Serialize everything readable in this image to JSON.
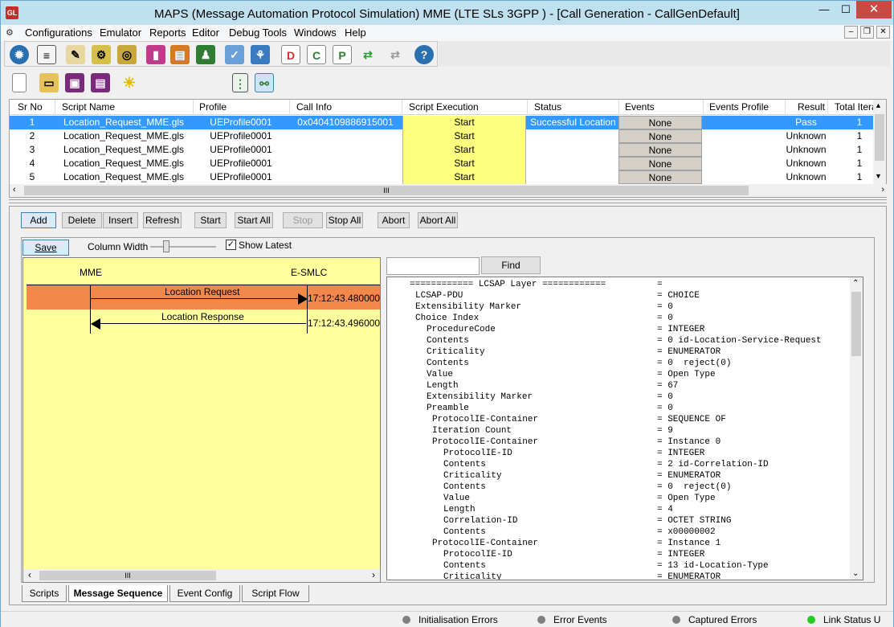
{
  "window": {
    "title": "MAPS (Message Automation Protocol Simulation) MME (LTE SLs 3GPP ) - [Call Generation  - CallGenDefault]",
    "app_icon": "GL",
    "controls": {
      "minimize": "—",
      "maximize": "☐",
      "close": "✕"
    }
  },
  "menu": {
    "items": [
      "Configurations",
      "Emulator",
      "Reports",
      "Editor",
      "Debug Tools",
      "Windows",
      "Help"
    ],
    "mdi_controls": {
      "minimize": "–",
      "restore": "❐",
      "close": "✕"
    }
  },
  "toolbar": {
    "icons": [
      "gear-icon",
      "notepad-icon",
      "script-edit-icon",
      "gears-icon",
      "coins-icon",
      "books-icon",
      "briefcase-icon",
      "user-lock-icon",
      "checklist-icon",
      "network-icon",
      "d-file-icon",
      "c-file-icon",
      "p-file-icon",
      "c-arrow-icon",
      "d-arrow-icon",
      "help-icon"
    ],
    "help_label": "?"
  },
  "grid": {
    "columns": [
      "Sr No",
      "Script Name",
      "Profile",
      "Call Info",
      "Script Execution",
      "Status",
      "Events",
      "Events Profile",
      "Result",
      "Total Itera"
    ],
    "rows": [
      {
        "sr": "1",
        "script": "Location_Request_MME.gls",
        "profile": "UEProfile0001",
        "callinfo": "0x0404109886915001",
        "exec": "Start",
        "status": "Successful Location ...",
        "events": "None",
        "events_profile": "",
        "result": "Pass",
        "iter": "1"
      },
      {
        "sr": "2",
        "script": "Location_Request_MME.gls",
        "profile": "UEProfile0001",
        "callinfo": "",
        "exec": "Start",
        "status": "",
        "events": "None",
        "events_profile": "",
        "result": "Unknown",
        "iter": "1"
      },
      {
        "sr": "3",
        "script": "Location_Request_MME.gls",
        "profile": "UEProfile0001",
        "callinfo": "",
        "exec": "Start",
        "status": "",
        "events": "None",
        "events_profile": "",
        "result": "Unknown",
        "iter": "1"
      },
      {
        "sr": "4",
        "script": "Location_Request_MME.gls",
        "profile": "UEProfile0001",
        "callinfo": "",
        "exec": "Start",
        "status": "",
        "events": "None",
        "events_profile": "",
        "result": "Unknown",
        "iter": "1"
      },
      {
        "sr": "5",
        "script": "Location_Request_MME.gls",
        "profile": "UEProfile0001",
        "callinfo": "",
        "exec": "Start",
        "status": "",
        "events": "None",
        "events_profile": "",
        "result": "Unknown",
        "iter": "1"
      }
    ],
    "scroll_grip": "III"
  },
  "actions": {
    "add": "Add",
    "delete": "Delete",
    "insert": "Insert",
    "refresh": "Refresh",
    "start": "Start",
    "start_all": "Start All",
    "stop": "Stop",
    "stop_all": "Stop All",
    "abort": "Abort",
    "abort_all": "Abort All"
  },
  "sequence": {
    "save": "Save",
    "column_width": "Column Width",
    "show_latest": "Show Latest",
    "show_latest_checked": true,
    "entity_left": "MME",
    "entity_right": "E-SMLC",
    "messages": [
      {
        "label": "Location Request",
        "time": "17:12:43.480000",
        "direction": "right",
        "highlight": "#f4874b"
      },
      {
        "label": "Location Response",
        "time": "17:12:43.496000",
        "direction": "left"
      }
    ],
    "scroll_grip": "III"
  },
  "decode": {
    "find_button": "Find",
    "find_value": "",
    "lines": [
      {
        "label": "============ LCSAP Layer ============",
        "value": "=",
        "indent": 0
      },
      {
        "label": "LCSAP-PDU",
        "value": "= CHOICE",
        "indent": 1
      },
      {
        "label": "Extensibility Marker",
        "value": "= 0",
        "indent": 1
      },
      {
        "label": "Choice Index",
        "value": "= 0",
        "indent": 1
      },
      {
        "label": "ProcedureCode",
        "value": "= INTEGER",
        "indent": 3
      },
      {
        "label": "Contents",
        "value": "= 0 id-Location-Service-Request",
        "indent": 3
      },
      {
        "label": "Criticality",
        "value": "= ENUMERATOR",
        "indent": 3
      },
      {
        "label": "Contents",
        "value": "= 0  reject(0)",
        "indent": 3
      },
      {
        "label": "Value",
        "value": "= Open Type",
        "indent": 3
      },
      {
        "label": "Length",
        "value": "= 67",
        "indent": 3
      },
      {
        "label": "Extensibility Marker",
        "value": "= 0",
        "indent": 3
      },
      {
        "label": "Preamble",
        "value": "= 0",
        "indent": 3
      },
      {
        "label": "ProtocolIE-Container",
        "value": "= SEQUENCE OF",
        "indent": 4
      },
      {
        "label": "Iteration Count",
        "value": "= 9",
        "indent": 4
      },
      {
        "label": "ProtocolIE-Container",
        "value": "= Instance 0",
        "indent": 4
      },
      {
        "label": "ProtocolIE-ID",
        "value": "= INTEGER",
        "indent": 6
      },
      {
        "label": "Contents",
        "value": "= 2 id-Correlation-ID",
        "indent": 6
      },
      {
        "label": "Criticality",
        "value": "= ENUMERATOR",
        "indent": 6
      },
      {
        "label": "Contents",
        "value": "= 0  reject(0)",
        "indent": 6
      },
      {
        "label": "Value",
        "value": "= Open Type",
        "indent": 6
      },
      {
        "label": "Length",
        "value": "= 4",
        "indent": 6
      },
      {
        "label": "Correlation-ID",
        "value": "= OCTET STRING",
        "indent": 6
      },
      {
        "label": "Contents",
        "value": "= x00000002",
        "indent": 6
      },
      {
        "label": "ProtocolIE-Container",
        "value": "= Instance 1",
        "indent": 4
      },
      {
        "label": "ProtocolIE-ID",
        "value": "= INTEGER",
        "indent": 6
      },
      {
        "label": "Contents",
        "value": "= 13 id-Location-Type",
        "indent": 6
      },
      {
        "label": "Criticality",
        "value": "= ENUMERATOR",
        "indent": 6
      }
    ]
  },
  "tabs": [
    "Scripts",
    "Message Sequence",
    "Event Config",
    "Script Flow"
  ],
  "active_tab": "Message Sequence",
  "status": {
    "items": [
      {
        "label": "Initialisation Errors",
        "color": "#7f7f7f"
      },
      {
        "label": "Error Events",
        "color": "#7f7f7f"
      },
      {
        "label": "Captured Errors",
        "color": "#7f7f7f"
      },
      {
        "label": "Link Status U",
        "color": "#22cc22"
      }
    ]
  },
  "colors": {
    "selected_row": "#3399ff",
    "start_cell": "#ffff7f",
    "sequence_bg": "#ffff9e",
    "request_highlight": "#f4874b"
  }
}
